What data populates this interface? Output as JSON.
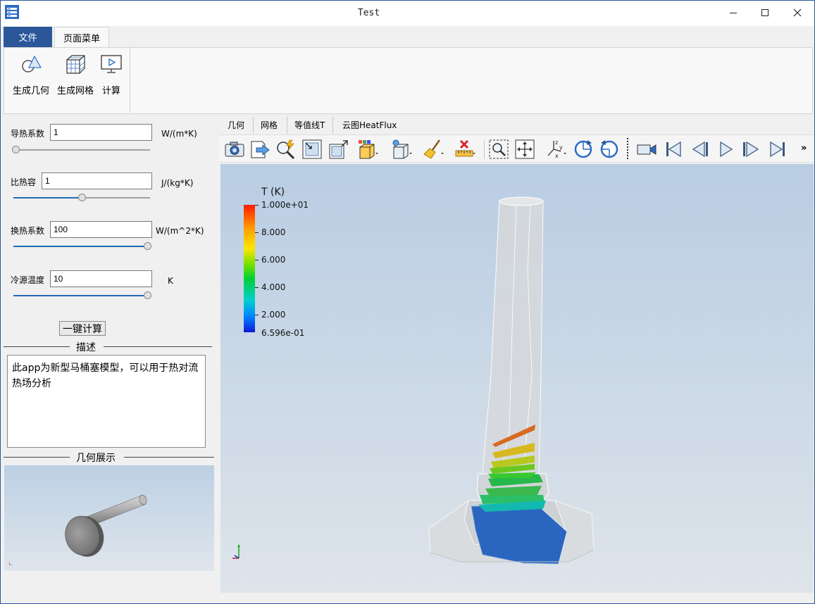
{
  "window": {
    "title": "Test"
  },
  "ribbon": {
    "tabs": [
      "文件",
      "页面菜单"
    ],
    "buttons": [
      "生成几何",
      "生成网格",
      "计算"
    ]
  },
  "params": {
    "conductivity": {
      "label": "导热系数",
      "value": "1",
      "unit": "W/(m*K)",
      "slider": 0.0
    },
    "heat_capacity": {
      "label": "比热容",
      "value": "1",
      "unit": "J/(kg*K)",
      "slider": 0.5
    },
    "htc": {
      "label": "换热系数",
      "value": "100",
      "unit": "W/(m^2*K)",
      "slider": 1.0
    },
    "cold_temp": {
      "label": "冷源温度",
      "value": "10",
      "unit": "K",
      "slider": 1.0
    }
  },
  "calc_button": "一键计算",
  "description": {
    "title": "描述",
    "text": "此app为新型马桶塞模型，可以用于热对流热场分析"
  },
  "preview": {
    "title": "几何展示"
  },
  "view_tabs": [
    "几何",
    "网格",
    "等值线T",
    "云图HeatFlux"
  ],
  "toolbar_icons": [
    "camera-icon",
    "export-icon",
    "zoom-auto-icon",
    "fit-box-icon",
    "expand-box-icon",
    "color-box-icon",
    "light-box-icon",
    "broom-icon",
    "clear-ruler-icon",
    "zoom-region-icon",
    "move-icon",
    "axes-icon",
    "rotate-cw-icon",
    "rotate-ccw-icon",
    "record-icon",
    "first-frame-icon",
    "prev-frame-icon",
    "play-icon",
    "next-frame-icon",
    "last-frame-icon"
  ],
  "toolbar_overflow": "»",
  "legend": {
    "title": "T (K)",
    "labels": [
      "1.000e+01",
      "8.000",
      "6.000",
      "4.000",
      "2.000",
      "6.596e-01"
    ],
    "colors": {
      "max": "#ff1a00",
      "min": "#0a1ad8"
    }
  },
  "colors": {
    "accent": "#2b579a",
    "slider": "#1e6ab4"
  }
}
